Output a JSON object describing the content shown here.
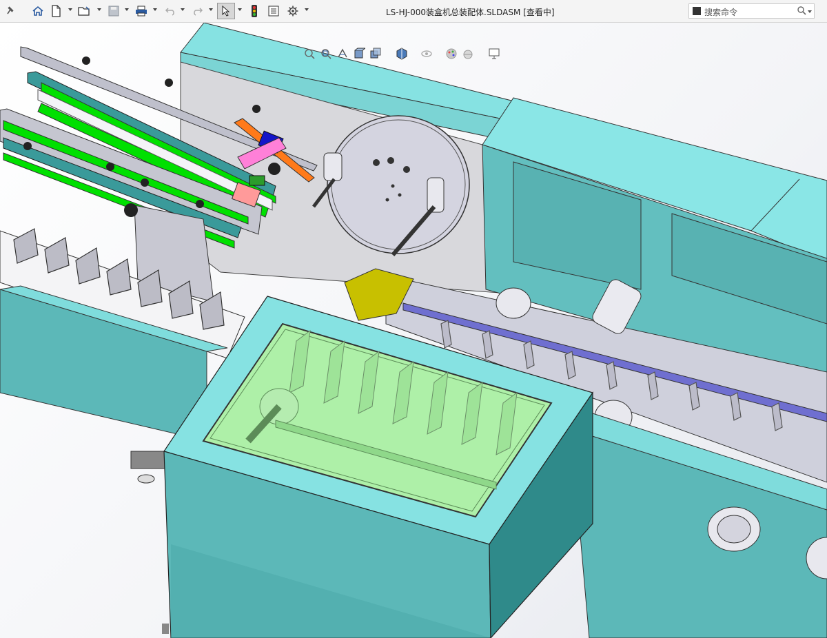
{
  "window": {
    "title": "LS-HJ-000装盒机总装配体.SLDASM [查看中]"
  },
  "toolbar": {
    "items": [
      "pin-icon",
      "home-icon",
      "new-file-icon",
      "open-file-icon",
      "save-icon",
      "print-icon",
      "undo-icon",
      "redo-icon",
      "select-cursor-icon",
      "traffic-light-icon",
      "file-properties-icon",
      "options-gear-icon"
    ]
  },
  "search": {
    "placeholder": "搜索命令"
  },
  "heads_up_toolbar": {
    "items": [
      "zoom-to-fit-icon",
      "zoom-to-area-icon",
      "previous-view-icon",
      "section-view-icon",
      "view-orientation-icon",
      "display-style-icon",
      "hide-show-icon",
      "edit-appearance-icon",
      "apply-scene-icon",
      "view-settings-icon"
    ]
  },
  "colors": {
    "cyan_panel": "#7fdcdc",
    "cyan_face": "#5cb8b8",
    "cyan_dark": "#2f8a8a",
    "frame_grey": "#c9c9d2",
    "green_belt": "#00e000",
    "yellow_part": "#c8c000",
    "orange_part": "#ff7a1a",
    "blue_part": "#1010c8",
    "pink_part": "#ff7ad0",
    "red_part": "#ff9090",
    "glass": "#aef0a8"
  }
}
